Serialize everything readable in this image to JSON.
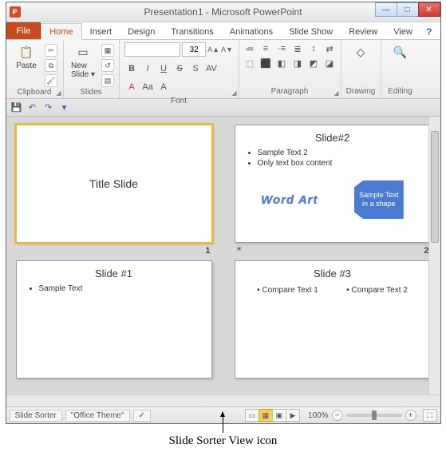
{
  "titlebar": {
    "icon_letter": "P",
    "title": "Presentation1 - Microsoft PowerPoint"
  },
  "win_controls": {
    "min": "—",
    "max": "□",
    "close": "✕"
  },
  "tabs": {
    "file": "File",
    "items": [
      "Home",
      "Insert",
      "Design",
      "Transitions",
      "Animations",
      "Slide Show",
      "Review",
      "View"
    ],
    "active_index": 0,
    "help": "?"
  },
  "ribbon": {
    "clipboard": {
      "label": "Clipboard",
      "paste": "Paste",
      "paste_icon": "📋",
      "cut_icon": "✂",
      "copy_icon": "⧉",
      "fmt_icon": "🖌"
    },
    "slides": {
      "label": "Slides",
      "new_slide": "New\nSlide ▾",
      "new_icon": "▭",
      "layout_icon": "▦",
      "reset_icon": "↺",
      "section_icon": "▤"
    },
    "font": {
      "label": "Font",
      "name_placeholder": "",
      "size": "32",
      "bold": "B",
      "italic": "I",
      "underline": "U",
      "strike": "S",
      "shadow": "S",
      "spacing": "AV",
      "clear": "A",
      "caps": "Aa",
      "grow": "A▲",
      "shrink": "A▼",
      "color": "A"
    },
    "paragraph": {
      "label": "Paragraph",
      "icons": [
        "≔",
        "≡",
        "·≡",
        "≣",
        "↕",
        "⇄",
        "⬚",
        "⬛",
        "◧",
        "◨",
        "◩",
        "◪"
      ]
    },
    "drawing": {
      "label": "Drawing",
      "icon": "◇"
    },
    "editing": {
      "label": "Editing",
      "icon": "🔍"
    }
  },
  "qat": {
    "save": "💾",
    "undo": "↶",
    "redo": "↷",
    "down": "▾"
  },
  "slides": [
    {
      "num": "1",
      "kind": "title",
      "title": "Title Slide",
      "selected": true
    },
    {
      "num": "2",
      "kind": "content",
      "title": "Slide#2",
      "bullets": [
        "Sample Text 2",
        "Only text box content"
      ],
      "wordart": "Word Art",
      "shape_text": "Sample Text in a shape",
      "transition": "✶"
    },
    {
      "num": "",
      "kind": "simple",
      "title": "Slide #1",
      "bullets": [
        "Sample Text"
      ]
    },
    {
      "num": "",
      "kind": "compare",
      "title": "Slide #3",
      "left": "Compare Text 1",
      "right": "Compare Text 2"
    }
  ],
  "statusbar": {
    "mode": "Slide Sorter",
    "theme": "\"Office Theme\"",
    "spell": "✓",
    "views": {
      "normal": "▭",
      "sorter": "▦",
      "reading": "▣",
      "show": "▶"
    },
    "zoom_pct": "100%",
    "minus": "−",
    "plus": "+",
    "fit": "⛶"
  },
  "callout": {
    "text": "Slide Sorter View icon"
  }
}
